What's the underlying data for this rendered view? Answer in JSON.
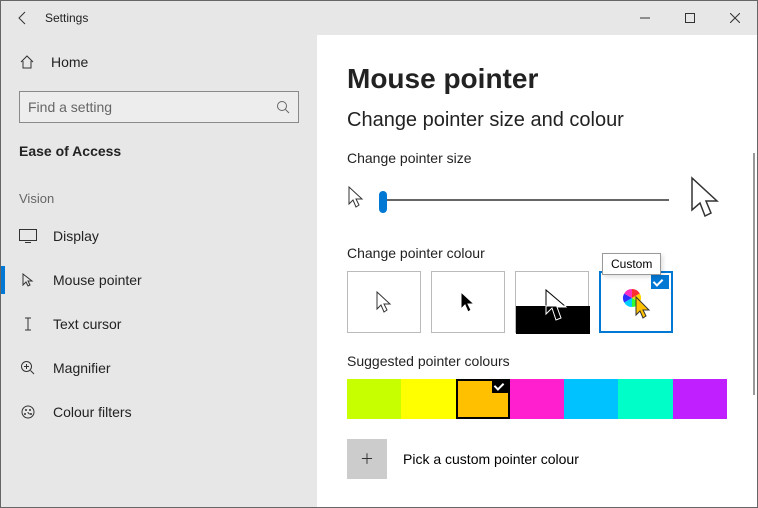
{
  "window": {
    "title": "Settings"
  },
  "sidebar": {
    "home": "Home",
    "search_placeholder": "Find a setting",
    "breadcrumb": "Ease of Access",
    "section": "Vision",
    "items": [
      {
        "label": "Display"
      },
      {
        "label": "Mouse pointer"
      },
      {
        "label": "Text cursor"
      },
      {
        "label": "Magnifier"
      },
      {
        "label": "Colour filters"
      }
    ]
  },
  "main": {
    "title": "Mouse pointer",
    "subtitle": "Change pointer size and colour",
    "size_label": "Change pointer size",
    "colour_label": "Change pointer colour",
    "colour_tooltip": "Custom",
    "suggested_label": "Suggested pointer colours",
    "swatches": [
      "#c8ff00",
      "#ffff00",
      "#ffc000",
      "#ff1fce",
      "#00c2ff",
      "#00ffc8",
      "#c020ff"
    ],
    "selected_swatch_index": 2,
    "custom_label": "Pick a custom pointer colour"
  }
}
